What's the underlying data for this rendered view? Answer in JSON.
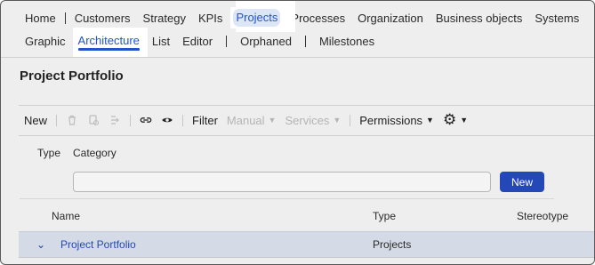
{
  "nav": {
    "top": [
      "Home",
      "Customers",
      "Strategy",
      "KPIs",
      "Projects",
      "Processes",
      "Organization",
      "Business objects",
      "Systems"
    ],
    "sub": [
      "Graphic",
      "Architecture",
      "List",
      "Editor",
      "Orphaned",
      "Milestones"
    ]
  },
  "page": {
    "title": "Project Portfolio"
  },
  "toolbar": {
    "new_label": "New",
    "filter_label": "Filter",
    "manual_label": "Manual",
    "services_label": "Services",
    "permissions_label": "Permissions"
  },
  "filter": {
    "type_label": "Type",
    "category_label": "Category",
    "category_value": "",
    "new_button": "New"
  },
  "table": {
    "columns": [
      "Name",
      "Type",
      "Stereotype"
    ],
    "rows": [
      {
        "name": "Project Portfolio",
        "type": "Projects",
        "stereotype": ""
      }
    ]
  },
  "colors": {
    "accent": "#2255cc",
    "button": "#2448b8",
    "row_highlight": "#d5dbe6"
  }
}
